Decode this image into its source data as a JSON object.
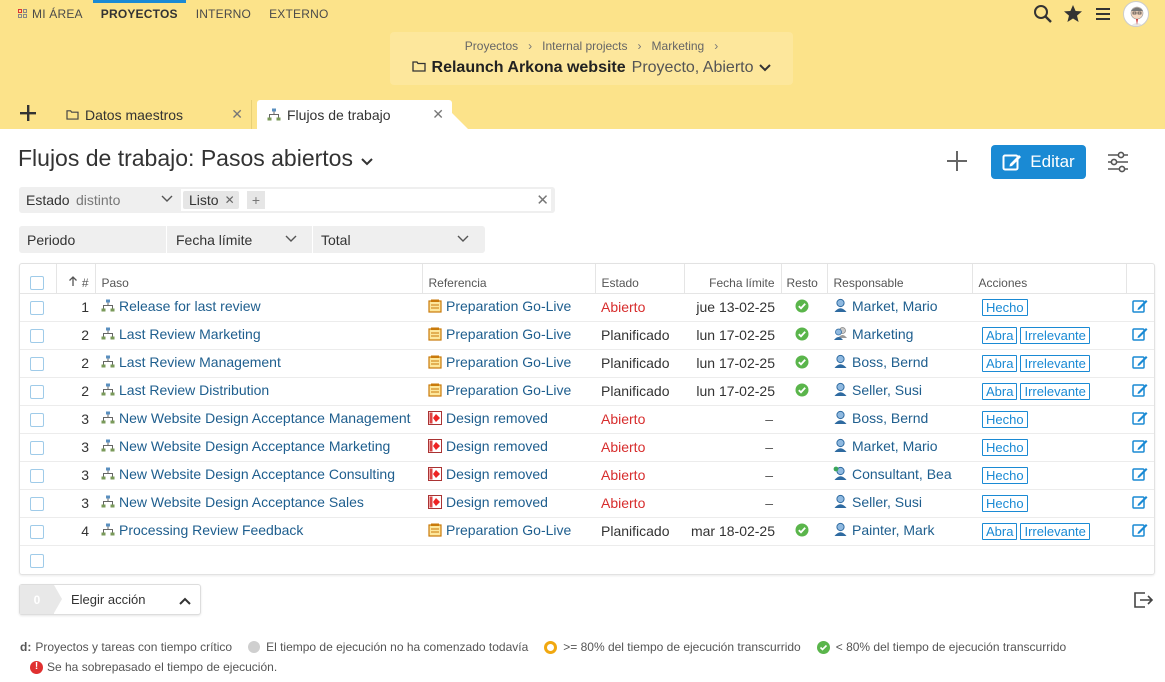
{
  "topnav": {
    "items": [
      "MI ÁREA",
      "PROYECTOS",
      "INTERNO",
      "EXTERNO"
    ],
    "active_index": 1
  },
  "header_icons": [
    "search-icon",
    "star-icon",
    "menu-icon",
    "avatar"
  ],
  "breadcrumb": {
    "items": [
      "Proyectos",
      "Internal projects",
      "Marketing"
    ],
    "title": "Relaunch Arkona website",
    "subtitle": "Proyecto, Abierto"
  },
  "tabs": [
    {
      "label": "Datos maestros",
      "icon": "folder-icon"
    },
    {
      "label": "Flujos de trabajo",
      "icon": "workflow-icon",
      "active": true
    }
  ],
  "page": {
    "title": "Flujos de trabajo: Pasos abiertos",
    "edit_label": "Editar"
  },
  "filter": {
    "field": "Estado",
    "operator": "distinto",
    "value": "Listo",
    "add": "+"
  },
  "filter2": {
    "label": "Periodo",
    "date_field": "Fecha límite",
    "range": "Total"
  },
  "table": {
    "columns": [
      "#",
      "Paso",
      "Referencia",
      "Estado",
      "Fecha límite",
      "Resto",
      "Responsable",
      "Acciones"
    ],
    "rows": [
      {
        "num": "1",
        "step": "Release for last review",
        "ref": "Preparation Go-Live",
        "ref_icon": "project-icon",
        "status": "Abierto",
        "status_color": "#d72d2d",
        "date": "jue 13-02-25",
        "rest": "check-icon",
        "resp": "Market, Mario",
        "resp_icon": "person-icon",
        "actions": [
          "Hecho"
        ]
      },
      {
        "num": "2",
        "step": "Last Review Marketing",
        "ref": "Preparation Go-Live",
        "ref_icon": "project-icon",
        "status": "Planificado",
        "status_color": "#333333",
        "date": "lun 17-02-25",
        "rest": "check-icon",
        "resp": "Marketing",
        "resp_icon": "group-icon",
        "actions": [
          "Abra",
          "Irrelevante"
        ]
      },
      {
        "num": "2",
        "step": "Last Review Management",
        "ref": "Preparation Go-Live",
        "ref_icon": "project-icon",
        "status": "Planificado",
        "status_color": "#333333",
        "date": "lun 17-02-25",
        "rest": "check-icon",
        "resp": "Boss, Bernd",
        "resp_icon": "person-icon",
        "actions": [
          "Abra",
          "Irrelevante"
        ]
      },
      {
        "num": "2",
        "step": "Last Review Distribution",
        "ref": "Preparation Go-Live",
        "ref_icon": "project-icon",
        "status": "Planificado",
        "status_color": "#333333",
        "date": "lun 17-02-25",
        "rest": "check-icon",
        "resp": "Seller, Susi",
        "resp_icon": "person-icon",
        "actions": [
          "Abra",
          "Irrelevante"
        ]
      },
      {
        "num": "3",
        "step": "New Website Design Acceptance Management",
        "ref": "Design removed",
        "ref_icon": "design-icon",
        "status": "Abierto",
        "status_color": "#d72d2d",
        "date": "–",
        "rest": "",
        "resp": "Boss, Bernd",
        "resp_icon": "person-icon",
        "actions": [
          "Hecho"
        ]
      },
      {
        "num": "3",
        "step": "New Website Design Acceptance Marketing",
        "ref": "Design removed",
        "ref_icon": "design-icon",
        "status": "Abierto",
        "status_color": "#d72d2d",
        "date": "–",
        "rest": "",
        "resp": "Market, Mario",
        "resp_icon": "person-icon",
        "actions": [
          "Hecho"
        ]
      },
      {
        "num": "3",
        "step": "New Website Design Acceptance Consulting",
        "ref": "Design removed",
        "ref_icon": "design-icon",
        "status": "Abierto",
        "status_color": "#d72d2d",
        "date": "–",
        "rest": "",
        "resp": "Consultant, Bea",
        "resp_icon": "external-person-icon",
        "actions": [
          "Hecho"
        ]
      },
      {
        "num": "3",
        "step": "New Website Design Acceptance Sales",
        "ref": "Design removed",
        "ref_icon": "design-icon",
        "status": "Abierto",
        "status_color": "#d72d2d",
        "date": "–",
        "rest": "",
        "resp": "Seller, Susi",
        "resp_icon": "person-icon",
        "actions": [
          "Hecho"
        ]
      },
      {
        "num": "4",
        "step": "Processing Review Feedback",
        "ref": "Preparation Go-Live",
        "ref_icon": "project-icon",
        "status": "Planificado",
        "status_color": "#333333",
        "date": "mar 18-02-25",
        "rest": "check-icon",
        "resp": "Painter, Mark",
        "resp_icon": "person-icon",
        "actions": [
          "Abra",
          "Irrelevante"
        ]
      }
    ]
  },
  "action_bar": {
    "count": "0",
    "label": "Elegir acción"
  },
  "legend": {
    "d_label": "d:",
    "critical": "Proyectos y tareas con tiempo crítico",
    "not_started": "El tiempo de ejecución no ha comenzado todavía",
    "over80": ">= 80% del tiempo de ejecución transcurrido",
    "under80": "< 80% del tiempo de ejecución transcurrido",
    "exceeded": "Se ha sobrepasado el tiempo de ejecución.",
    "colors": {
      "not_started": "#cfcfcf",
      "over80": "#f1a810",
      "under80": "#5ab54b",
      "exceeded": "#e03030"
    }
  },
  "colors": {
    "accent": "#1a8ad4",
    "header_bg": "#fce38a",
    "link": "#1e5e8e",
    "open_status": "#d72d2d"
  }
}
